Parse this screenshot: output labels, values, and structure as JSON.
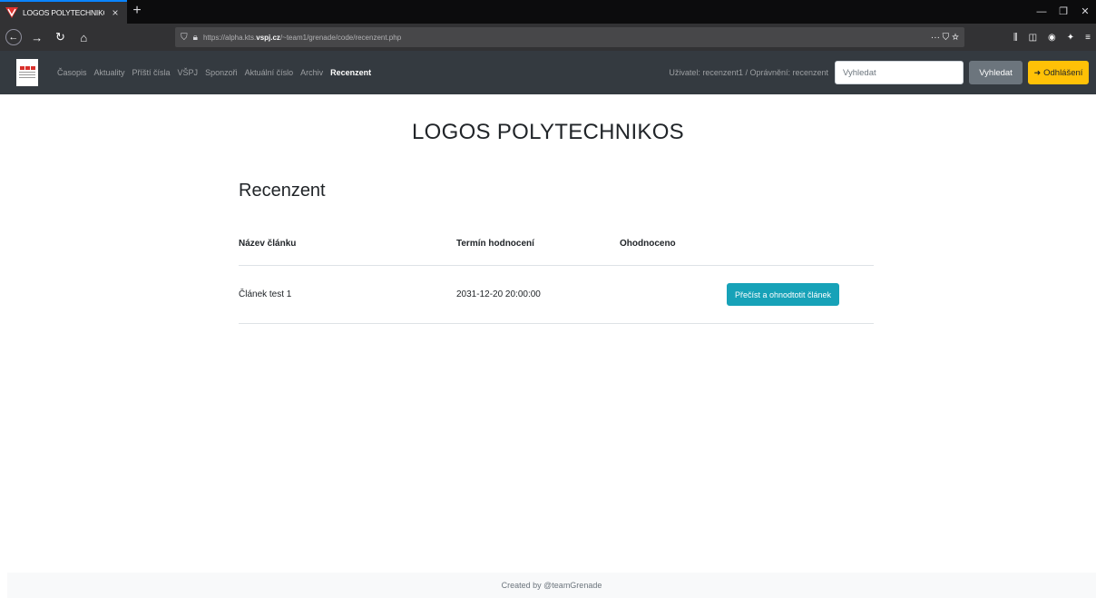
{
  "browser": {
    "tab_title": "LOGOS POLYTECHNIKOS",
    "tab_close": "×",
    "new_tab": "+",
    "url_prefix": "https://alpha.kts.",
    "url_domain": "vspj.cz",
    "url_path": "/~team1/grenade/code/recenzent.php",
    "url_actions": "··· ⛉ ☆"
  },
  "nav": {
    "links": [
      "Časopis",
      "Aktuality",
      "Příští čísla",
      "VŠPJ",
      "Sponzoři",
      "Aktuální číslo",
      "Archiv",
      "Recenzent"
    ],
    "active_index": 7,
    "user_info": "Uživatel: recenzent1 / Oprávnění: recenzent",
    "search_placeholder": "Vyhledat",
    "search_button": "Vyhledat",
    "logout_button": "Odhlášení"
  },
  "page": {
    "title": "LOGOS POLYTECHNIKOS",
    "section_heading": "Recenzent"
  },
  "table": {
    "headers": [
      "Název článku",
      "Termín hodnocení",
      "Ohodnoceno"
    ],
    "rows": [
      {
        "title": "Článek test 1",
        "deadline": "2031-12-20 20:00:00",
        "rated": "",
        "action": "Přečíst a ohnodtotit článek"
      }
    ]
  },
  "footer": {
    "text": "Created by @teamGrenade"
  },
  "colors": {
    "navbar_bg": "#343a40",
    "info_button": "#17a2b8",
    "warning_button": "#ffc107",
    "secondary_button": "#6c757d"
  }
}
